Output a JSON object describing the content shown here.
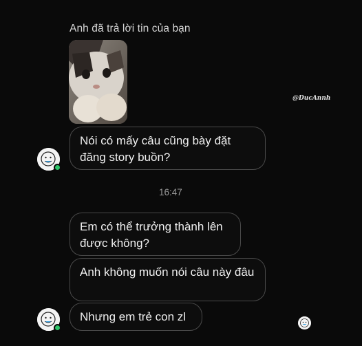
{
  "conversation": {
    "reply_header": "Anh đã trả lời tin của bạn",
    "story_reply": "Nói có mấy câu cũng bày đặt đăng story buồn?",
    "timestamp": "16:47",
    "messages": [
      "Em có thể trưởng thành lên được không?",
      "Anh không muốn nói câu này đâu",
      "Nhưng em trẻ con zl"
    ]
  },
  "watermark": "@DucAnnh",
  "colors": {
    "background": "#0a0a0a",
    "bubble_border": "#4a4a4a",
    "online_dot": "#2ec56a",
    "text": "#f0f0f0",
    "timestamp": "#9a9a9a"
  },
  "icons": {
    "avatar": "cartoon-face-avatar",
    "story": "cat-photo-thumbnail",
    "status": "online-dot",
    "seen": "seen-avatar-icon"
  }
}
